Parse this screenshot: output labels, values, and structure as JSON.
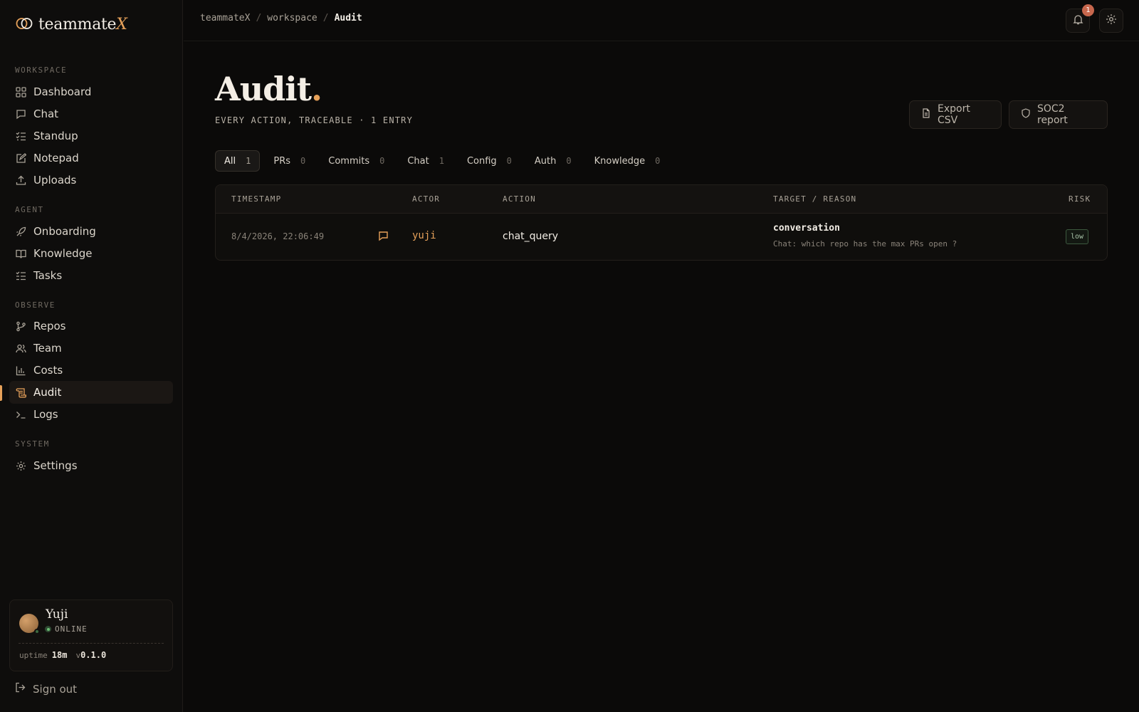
{
  "app": {
    "name": "teammate",
    "name_accent": "X"
  },
  "sidebar": {
    "sections": [
      {
        "label": "WORKSPACE",
        "items": [
          {
            "label": "Dashboard",
            "icon": "grid-icon"
          },
          {
            "label": "Chat",
            "icon": "message-icon"
          },
          {
            "label": "Standup",
            "icon": "checklist-icon"
          },
          {
            "label": "Notepad",
            "icon": "notepad-icon"
          },
          {
            "label": "Uploads",
            "icon": "upload-icon"
          }
        ]
      },
      {
        "label": "AGENT",
        "items": [
          {
            "label": "Onboarding",
            "icon": "rocket-icon"
          },
          {
            "label": "Knowledge",
            "icon": "book-icon"
          },
          {
            "label": "Tasks",
            "icon": "list-check-icon"
          }
        ]
      },
      {
        "label": "OBSERVE",
        "items": [
          {
            "label": "Repos",
            "icon": "git-branch-icon"
          },
          {
            "label": "Team",
            "icon": "users-icon"
          },
          {
            "label": "Costs",
            "icon": "bar-chart-icon"
          },
          {
            "label": "Audit",
            "icon": "scroll-icon",
            "active": true
          },
          {
            "label": "Logs",
            "icon": "terminal-icon"
          }
        ]
      },
      {
        "label": "SYSTEM",
        "items": [
          {
            "label": "Settings",
            "icon": "gear-icon"
          }
        ]
      }
    ],
    "user": {
      "name": "Yuji",
      "status": "ONLINE",
      "uptime_label": "uptime",
      "uptime_value": "18m",
      "version_prefix": "v",
      "version": "0.1.0"
    },
    "sign_out": "Sign out"
  },
  "topbar": {
    "breadcrumbs": [
      "teammateX",
      "workspace",
      "Audit"
    ],
    "separator": "/",
    "notifications_count": "1"
  },
  "page": {
    "title": "Audit",
    "title_dot": ".",
    "subtitle": "EVERY ACTION, TRACEABLE · 1 ENTRY",
    "export_label": "Export CSV",
    "soc2_label": "SOC2 report"
  },
  "filters": [
    {
      "label": "All",
      "count": "1",
      "active": true
    },
    {
      "label": "PRs",
      "count": "0"
    },
    {
      "label": "Commits",
      "count": "0"
    },
    {
      "label": "Chat",
      "count": "1"
    },
    {
      "label": "Config",
      "count": "0"
    },
    {
      "label": "Auth",
      "count": "0"
    },
    {
      "label": "Knowledge",
      "count": "0"
    }
  ],
  "table": {
    "columns": [
      "TIMESTAMP",
      "ACTOR",
      "ACTION",
      "TARGET / REASON",
      "RISK"
    ],
    "rows": [
      {
        "timestamp": "8/4/2026, 22:06:49",
        "type_icon": "chat-bubble-icon",
        "actor": "yuji",
        "action": "chat_query",
        "target": "conversation",
        "reason": "Chat: which repo has the max PRs open ?",
        "risk": "low"
      }
    ]
  },
  "colors": {
    "accent": "#e6a15a",
    "background": "#0b0a09",
    "risk_low": "#3d5a3f",
    "badge": "#c7674d"
  }
}
